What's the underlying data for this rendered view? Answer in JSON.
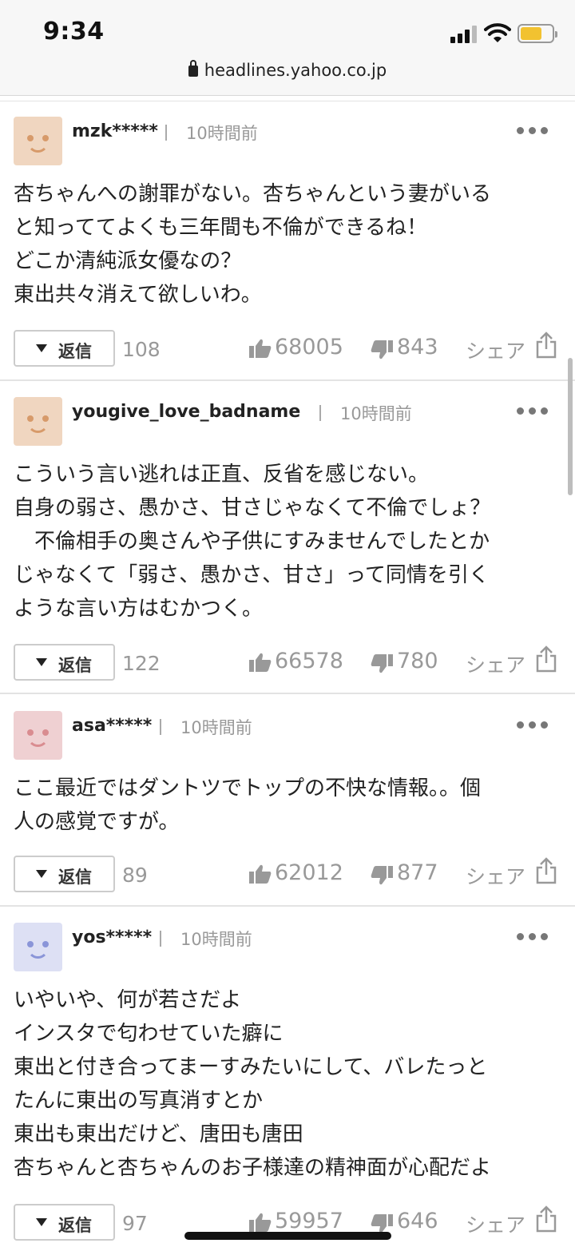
{
  "status_bar": {
    "time": "9:34"
  },
  "url_bar": {
    "domain": "headlines.yahoo.co.jp"
  },
  "colors": {
    "avatar_orange": "#f0d6c0",
    "avatar_orange_face": "#d79a6a",
    "avatar_pink": "#efd0d2",
    "avatar_pink_face": "#d98c90",
    "avatar_blue": "#dde0f4",
    "avatar_blue_face": "#8a95d8"
  },
  "labels": {
    "reply": "返信",
    "share": "シェア"
  },
  "comments": [
    {
      "username": "mzk*****",
      "time": "10時間前",
      "avatar": "smile-face-orange",
      "body": "杏ちゃんへの謝罪がない。杏ちゃんという妻がいる\nと知っててよくも三年間も不倫ができるね！\nどこか清純派女優なの？\n東出共々消えて欲しいわ。",
      "reply_count": "108",
      "likes": "68005",
      "dislikes": "843"
    },
    {
      "username": "yougive_love_badname",
      "time": "10時間前",
      "avatar": "smile-face-orange",
      "body": "こういう言い逃れは正直、反省を感じない。\n自身の弱さ、愚かさ、甘さじゃなくて不倫でしょ？\n　不倫相手の奥さんや子供にすみませんでしたとか\nじゃなくて「弱さ、愚かさ、甘さ」って同情を引く\nような言い方はむかつく。",
      "reply_count": "122",
      "likes": "66578",
      "dislikes": "780"
    },
    {
      "username": "asa*****",
      "time": "10時間前",
      "avatar": "smile-face-pink",
      "body": "ここ最近ではダントツでトップの不快な情報。。個\n人の感覚ですが。",
      "reply_count": "89",
      "likes": "62012",
      "dislikes": "877"
    },
    {
      "username": "yos*****",
      "time": "10時間前",
      "avatar": "smile-face-blue",
      "body": "いやいや、何が若さだよ\nインスタで匂わせていた癖に\n東出と付き合ってまーすみたいにして、バレたっと\nたんに東出の写真消すとか\n東出も東出だけど、唐田も唐田\n杏ちゃんと杏ちゃんのお子様達の精神面が心配だよ",
      "reply_count": "97",
      "likes": "59957",
      "dislikes": "646"
    }
  ]
}
